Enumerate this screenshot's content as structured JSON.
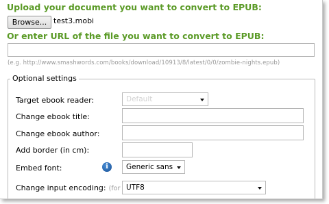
{
  "upload": {
    "heading": "Upload your document you want to convert to EPUB:",
    "browse_label": "Browse...",
    "file_name": "test3.mobi"
  },
  "url": {
    "heading": "Or enter URL of the file you want to convert to EPUB:",
    "value": "",
    "hint": "(e.g. http://www.smashwords.com/books/download/10913/8/latest/0/0/zombie-nights.epub)"
  },
  "optional": {
    "legend": "Optional settings",
    "target_reader": {
      "label": "Target ebook reader:",
      "value": "Default"
    },
    "title": {
      "label": "Change ebook title:",
      "value": ""
    },
    "author": {
      "label": "Change ebook author:",
      "value": ""
    },
    "border": {
      "label": "Add border (in cm):",
      "value": ""
    },
    "embed_font": {
      "label": "Embed font:",
      "icon": "info-icon",
      "value": "Generic sans"
    },
    "encoding": {
      "label": "Change input encoding:",
      "hint": "(for",
      "value": "UTF8"
    }
  },
  "colors": {
    "heading": "#5a9a26",
    "hint": "#9a9a9a",
    "info_icon": "#2a6bb8"
  }
}
